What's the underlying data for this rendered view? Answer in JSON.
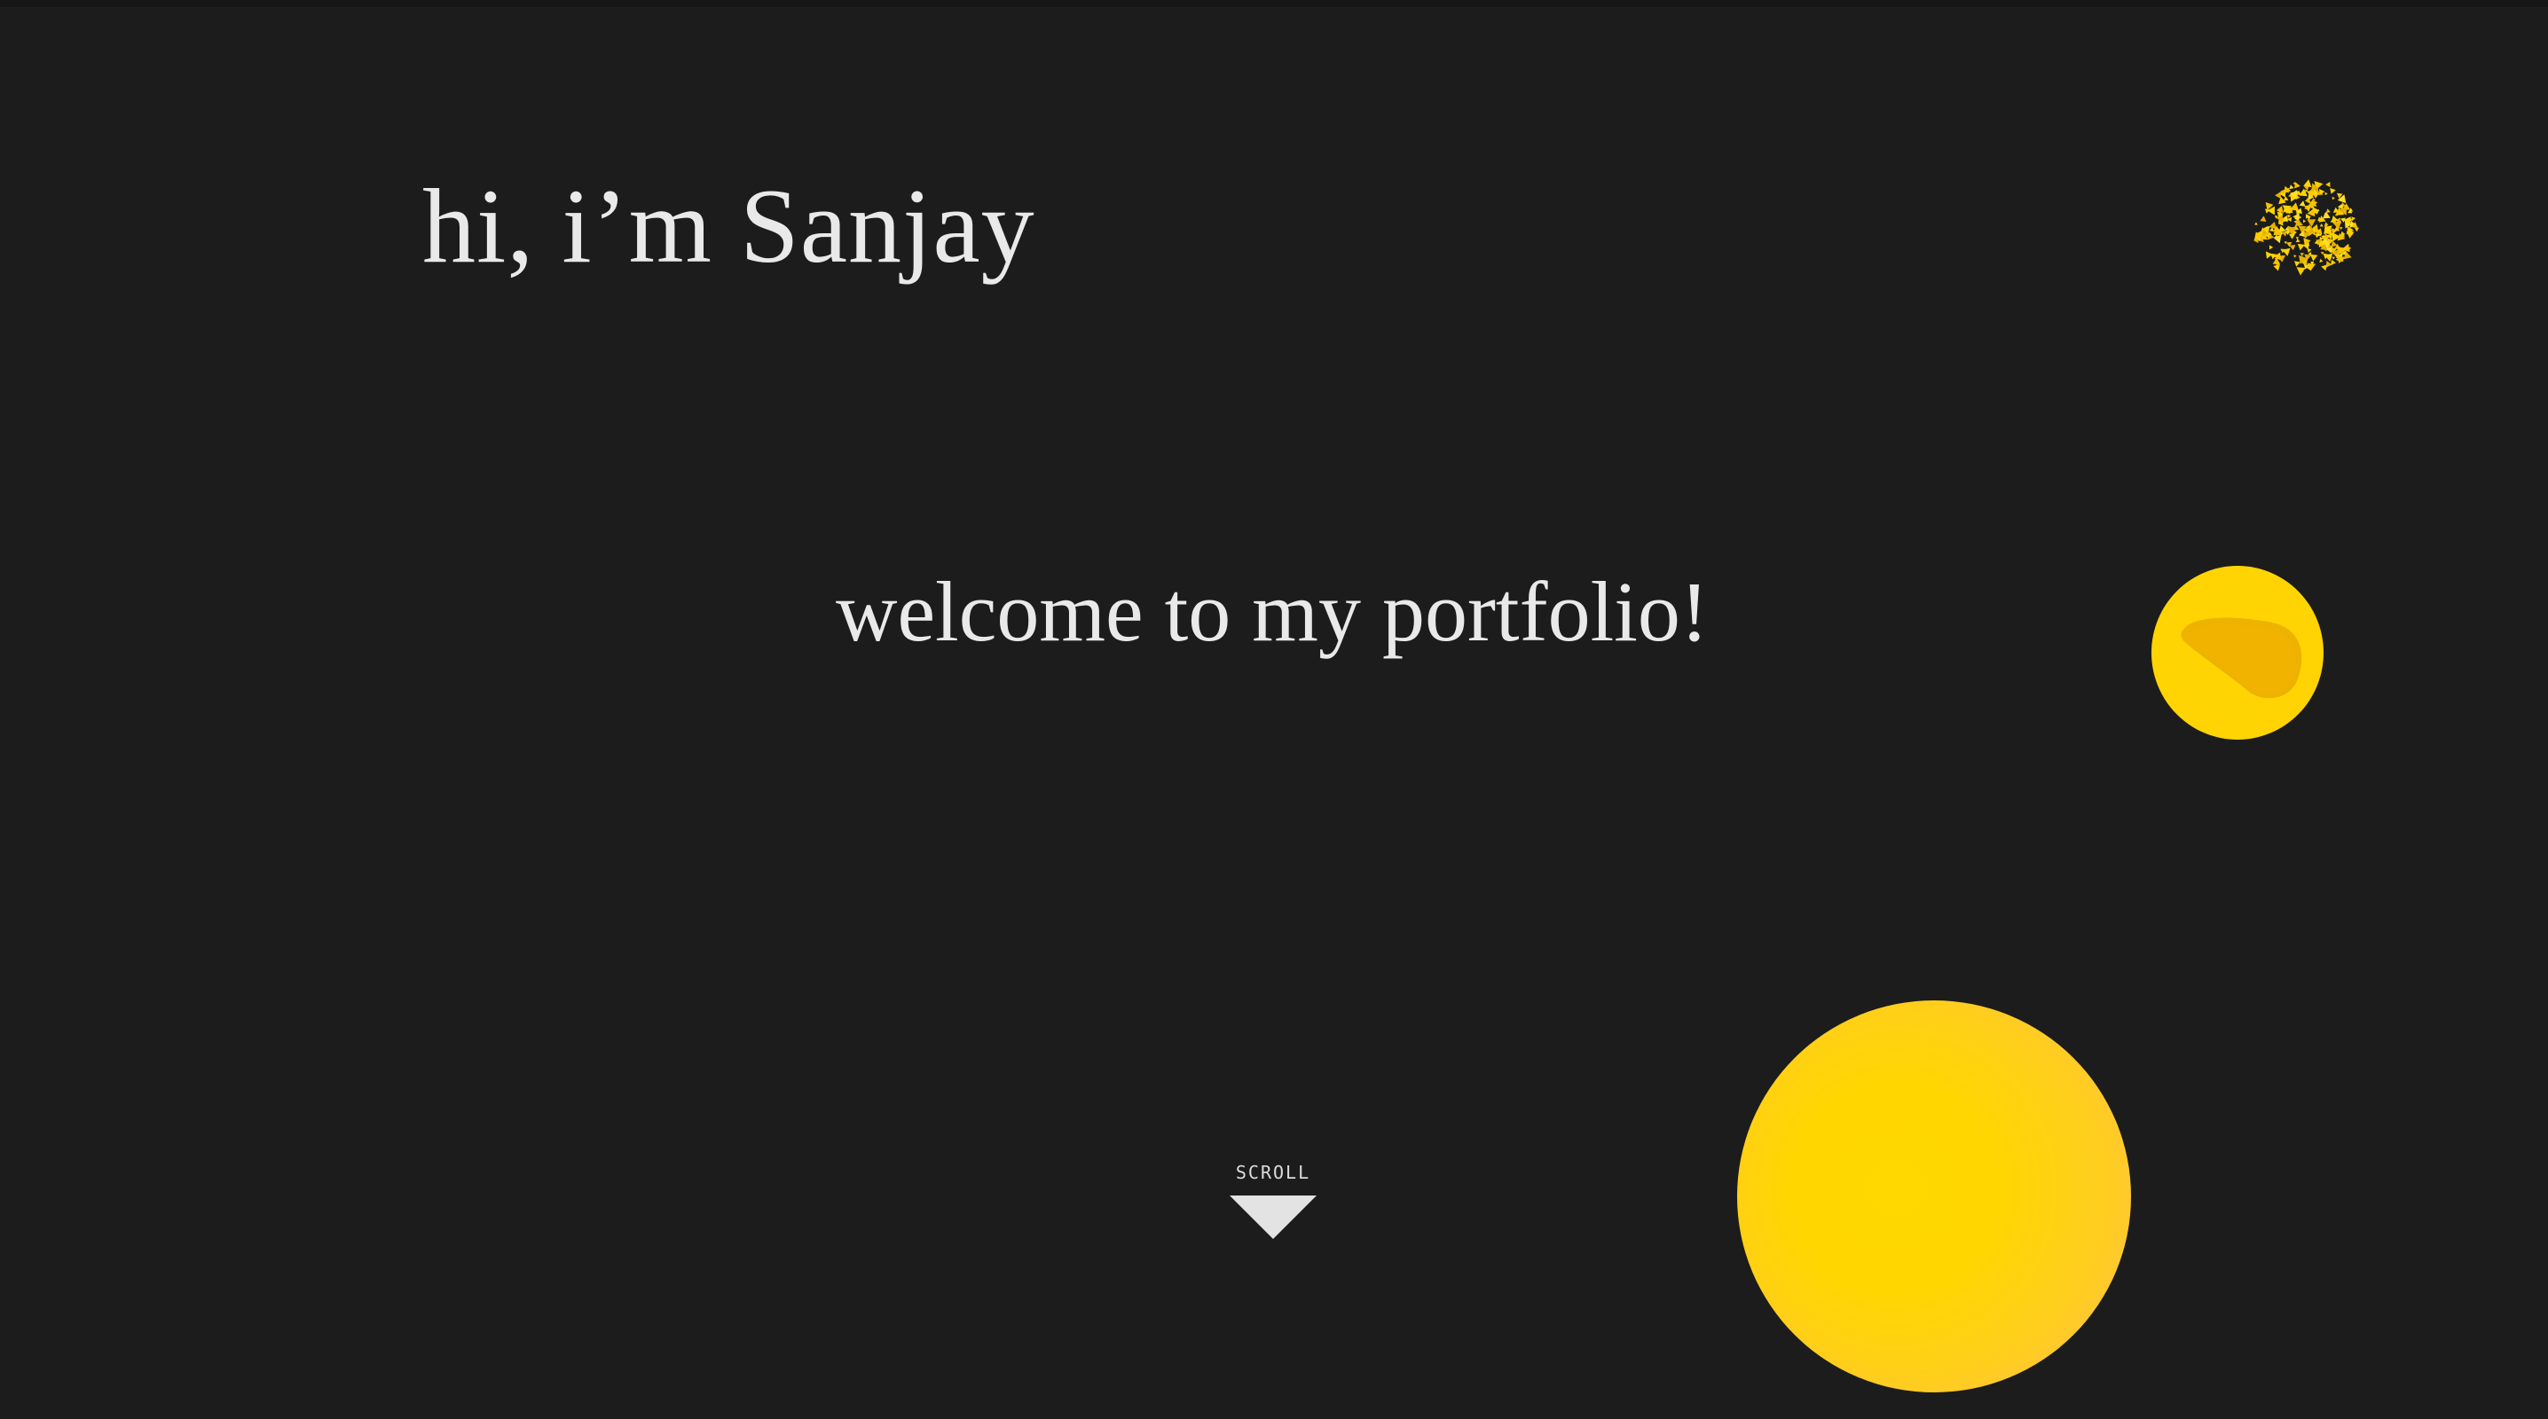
{
  "hero": {
    "title": "hi, i’m Sanjay",
    "subtitle": "welcome to my portfolio!"
  },
  "scroll": {
    "label": "SCROLL"
  },
  "icons": {
    "particles": "yellow-particle-cluster-icon",
    "blob": "yellow-blob-icon",
    "sphere": "yellow-sphere"
  },
  "colors": {
    "background": "#1c1c1d",
    "text": "#e9e9e9",
    "accent": "#ffd402",
    "accent_dark": "#f0b400"
  }
}
